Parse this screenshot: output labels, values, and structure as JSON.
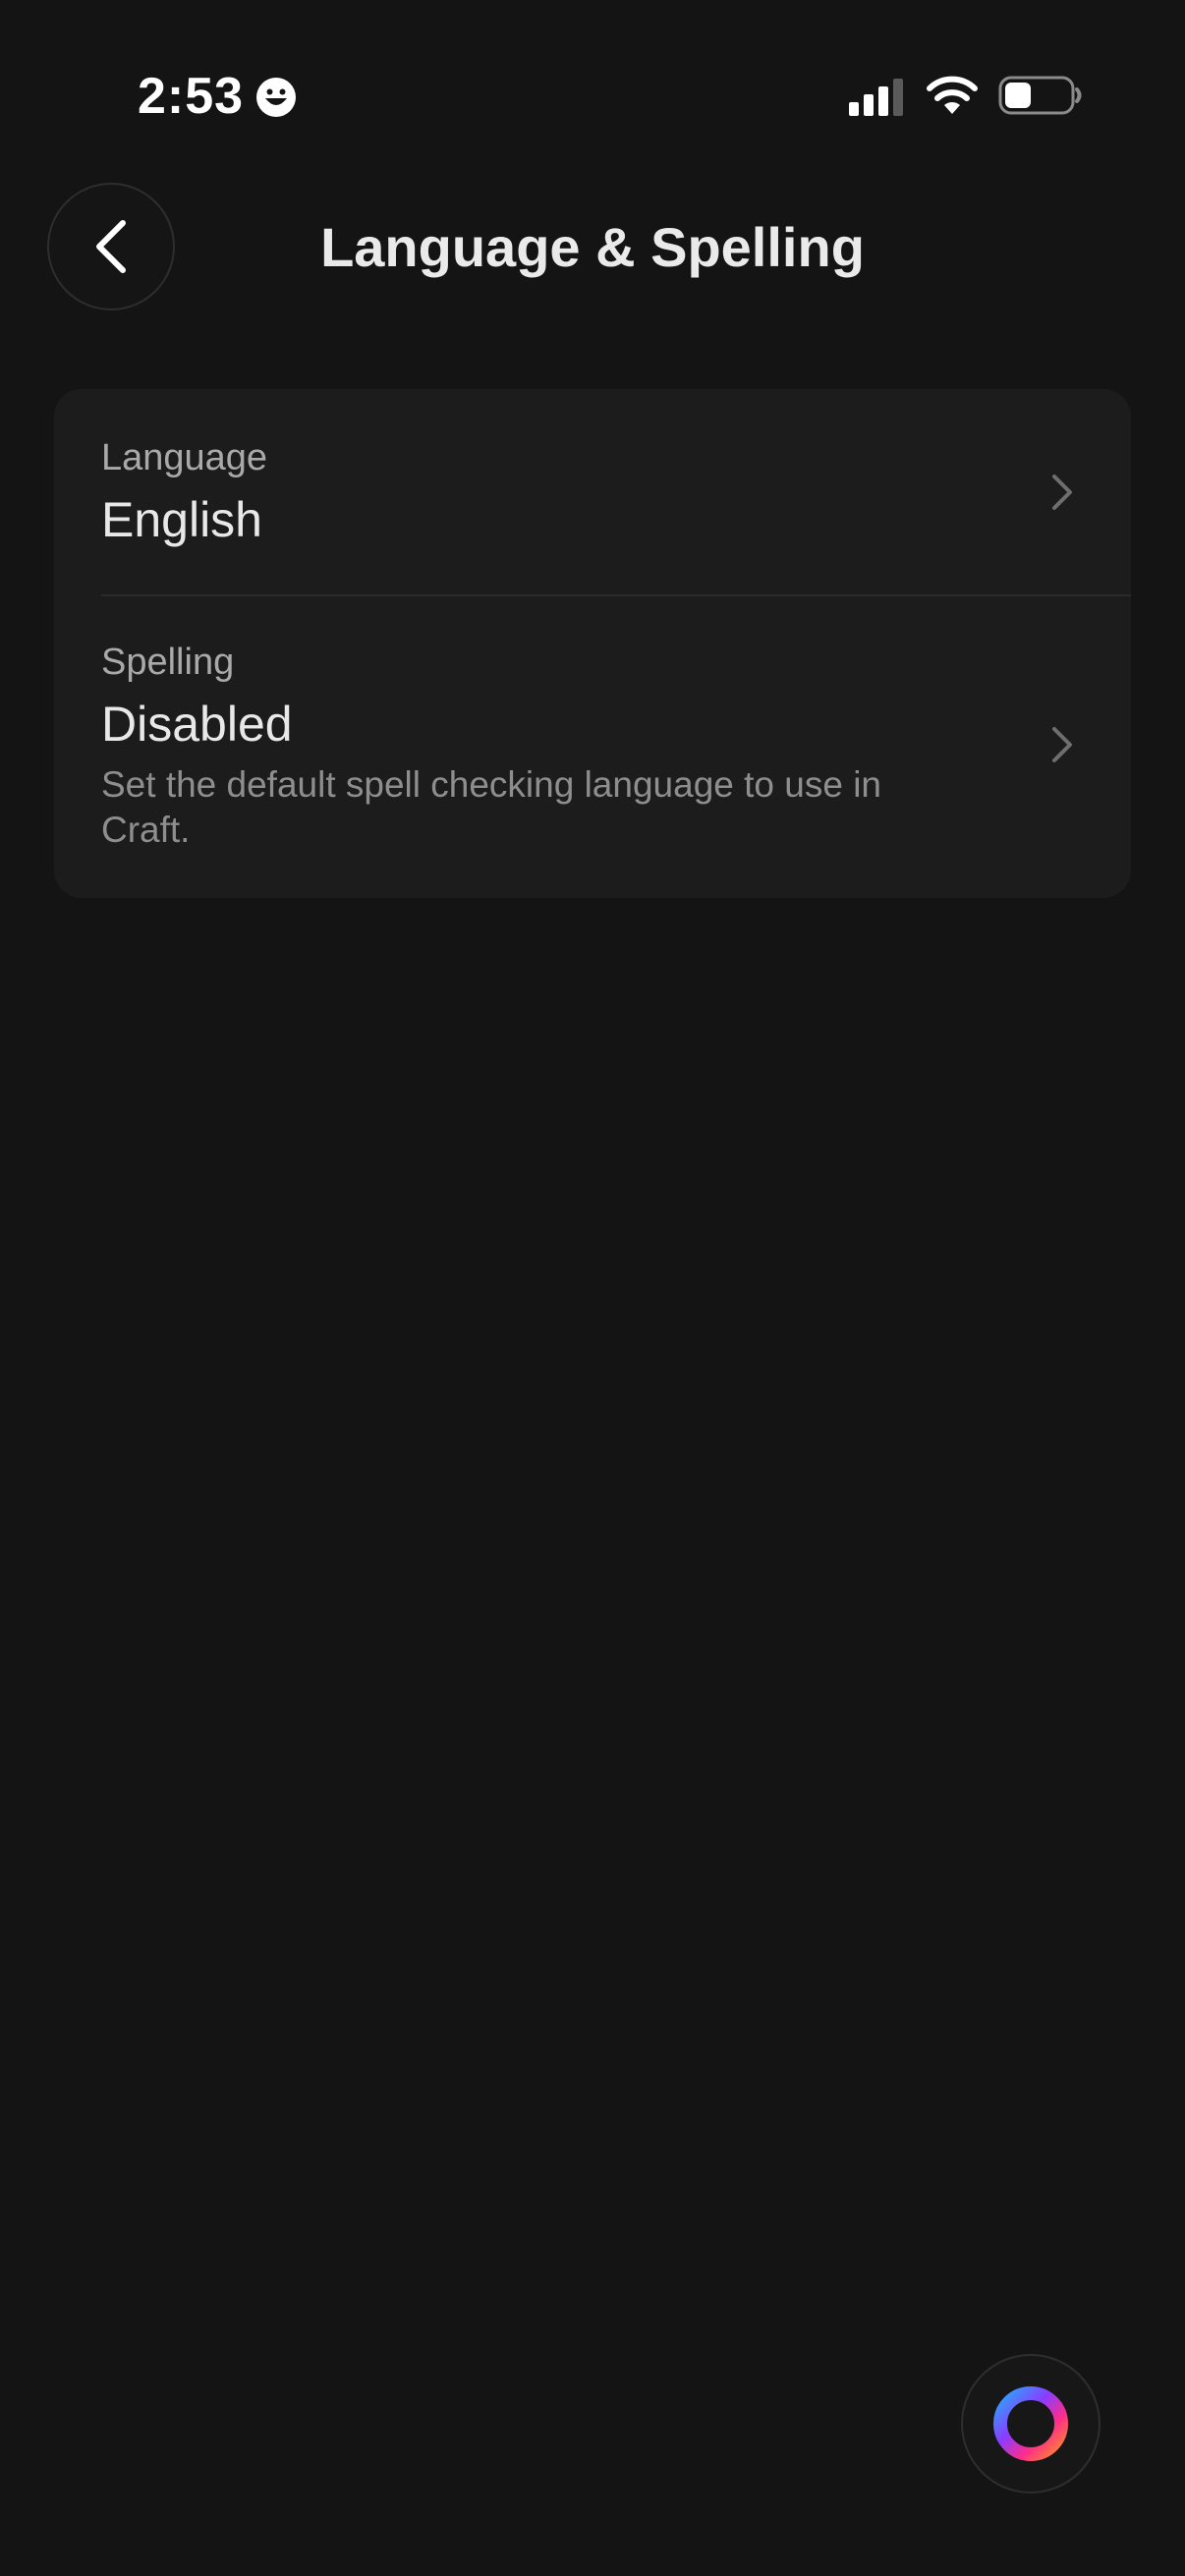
{
  "status_bar": {
    "time": "2:53",
    "emoji_icon": "grinning-face-icon",
    "signal_icon": "cellular-signal-icon",
    "wifi_icon": "wifi-icon",
    "battery_icon": "battery-icon",
    "battery_level": 0.4
  },
  "header": {
    "back_icon": "chevron-left-icon",
    "title": "Language & Spelling"
  },
  "settings": {
    "language": {
      "label": "Language",
      "value": "English",
      "icon": "chevron-right-icon"
    },
    "spelling": {
      "label": "Spelling",
      "value": "Disabled",
      "description": "Set the default spell checking language to use in Craft.",
      "icon": "chevron-right-icon"
    }
  },
  "assistant": {
    "icon": "assistant-ring-icon"
  },
  "colors": {
    "background": "#141414",
    "card": "#1c1c1c",
    "text_primary": "#e8e8e8",
    "text_secondary": "#a9a9a9",
    "text_tertiary": "#8e8e8e",
    "gradient": [
      "#2aa8ff",
      "#8a3cff",
      "#ff2d8a",
      "#ff8a2d"
    ]
  }
}
